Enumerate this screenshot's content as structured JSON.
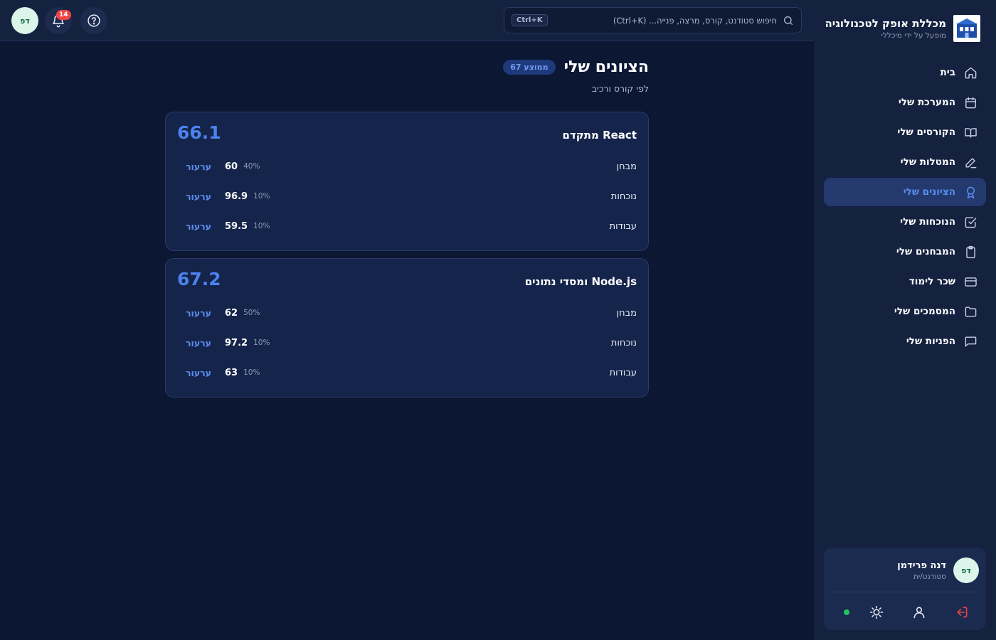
{
  "brand": {
    "name": "מכללת אופק לטכנולוגיה",
    "subtitle": "מופעל על ידי מיכללי",
    "logo_icon": "building-logo-icon"
  },
  "nav": {
    "items": [
      {
        "label": "בית",
        "icon": "home-icon",
        "active": false
      },
      {
        "label": "המערכת שלי",
        "icon": "calendar-icon",
        "active": false
      },
      {
        "label": "הקורסים שלי",
        "icon": "book-open-icon",
        "active": false
      },
      {
        "label": "המטלות שלי",
        "icon": "pencil-icon",
        "active": false
      },
      {
        "label": "הציונים שלי",
        "icon": "award-icon",
        "active": true
      },
      {
        "label": "הנוכחות שלי",
        "icon": "check-square-icon",
        "active": false
      },
      {
        "label": "המבחנים שלי",
        "icon": "clipboard-icon",
        "active": false
      },
      {
        "label": "שכר לימוד",
        "icon": "credit-card-icon",
        "active": false
      },
      {
        "label": "המסמכים שלי",
        "icon": "folder-icon",
        "active": false
      },
      {
        "label": "הפניות שלי",
        "icon": "message-square-icon",
        "active": false
      }
    ]
  },
  "user": {
    "initials": "דפ",
    "name": "דנה פרידמן",
    "role": "סטודנט/ית",
    "status": "online"
  },
  "topbar": {
    "search_placeholder": "חיפוש סטודנט, קורס, מרצה, פנייה... (Ctrl+K)",
    "shortcut": "Ctrl+K",
    "notifications_count": "14",
    "avatar_initials": "דפ"
  },
  "page": {
    "title": "הציונים שלי",
    "average_badge": "ממוצע 67",
    "subtitle": "לפי קורס ורכיב"
  },
  "courses": [
    {
      "title": "React מתקדם",
      "average": "66.1",
      "components": [
        {
          "name": "מבחן",
          "score": "60",
          "weight": "40%",
          "action": "ערעור"
        },
        {
          "name": "נוכחות",
          "score": "96.9",
          "weight": "10%",
          "action": "ערעור"
        },
        {
          "name": "עבודות",
          "score": "59.5",
          "weight": "10%",
          "action": "ערעור"
        }
      ]
    },
    {
      "title": "Node.js ומסדי נתונים",
      "average": "67.2",
      "components": [
        {
          "name": "מבחן",
          "score": "62",
          "weight": "50%",
          "action": "ערעור"
        },
        {
          "name": "נוכחות",
          "score": "97.2",
          "weight": "10%",
          "action": "ערעור"
        },
        {
          "name": "עבודות",
          "score": "63",
          "weight": "10%",
          "action": "ערעור"
        }
      ]
    }
  ],
  "colors": {
    "background": "#0b1733",
    "sidebar": "#14213f",
    "accent": "#4c82ee",
    "danger": "#ef4444",
    "online": "#22c55e"
  }
}
